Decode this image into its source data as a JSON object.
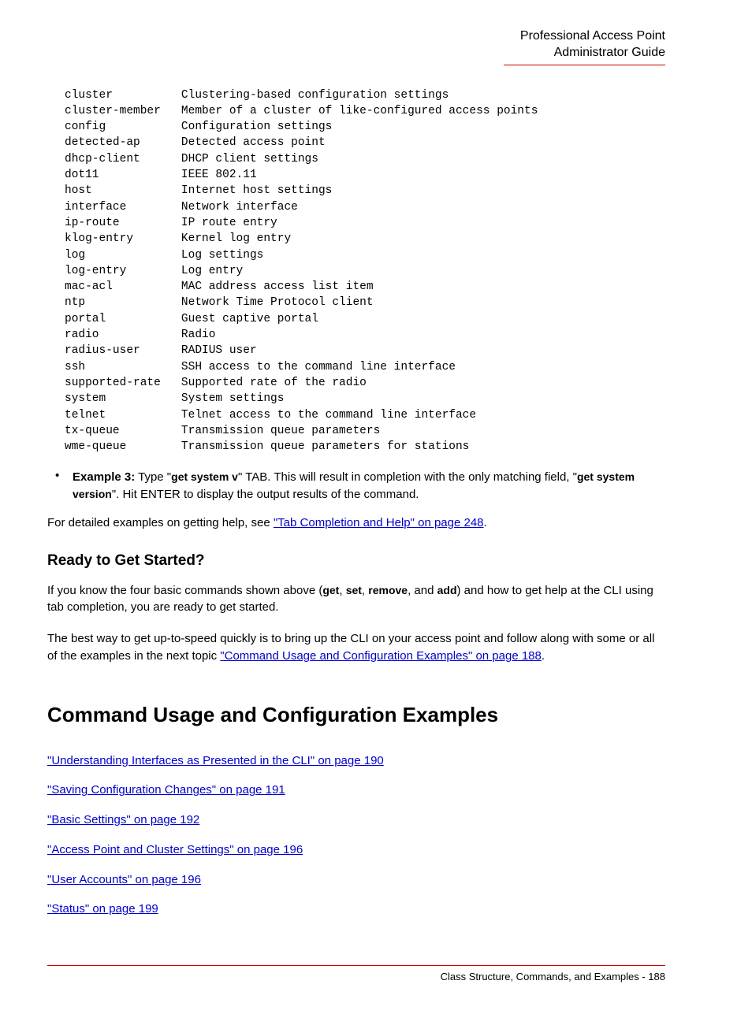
{
  "header": {
    "line1": "Professional Access Point",
    "line2": "Administrator Guide"
  },
  "mono_table": [
    {
      "k": "cluster",
      "v": "Clustering-based configuration settings"
    },
    {
      "k": "cluster-member",
      "v": "Member of a cluster of like-configured access points"
    },
    {
      "k": "config",
      "v": "Configuration settings"
    },
    {
      "k": "detected-ap",
      "v": "Detected access point"
    },
    {
      "k": "dhcp-client",
      "v": "DHCP client settings"
    },
    {
      "k": "dot11",
      "v": "IEEE 802.11"
    },
    {
      "k": "host",
      "v": "Internet host settings"
    },
    {
      "k": "interface",
      "v": "Network interface"
    },
    {
      "k": "ip-route",
      "v": "IP route entry"
    },
    {
      "k": "klog-entry",
      "v": "Kernel log entry"
    },
    {
      "k": "log",
      "v": "Log settings"
    },
    {
      "k": "log-entry",
      "v": "Log entry"
    },
    {
      "k": "mac-acl",
      "v": "MAC address access list item"
    },
    {
      "k": "ntp",
      "v": "Network Time Protocol client"
    },
    {
      "k": "portal",
      "v": "Guest captive portal"
    },
    {
      "k": "radio",
      "v": "Radio"
    },
    {
      "k": "radius-user",
      "v": "RADIUS user"
    },
    {
      "k": "ssh",
      "v": "SSH access to the command line interface"
    },
    {
      "k": "supported-rate",
      "v": "Supported rate of the radio"
    },
    {
      "k": "system",
      "v": "System settings"
    },
    {
      "k": "telnet",
      "v": "Telnet access to the command line interface"
    },
    {
      "k": "tx-queue",
      "v": "Transmission queue parameters"
    },
    {
      "k": "wme-queue",
      "v": "Transmission queue parameters for stations"
    }
  ],
  "example3": {
    "label": "Example 3:",
    "t1": " Type \"",
    "cmd1": "get system v",
    "t2": "\" TAB. This will result in completion with the only matching field, \"",
    "cmd2": "get system version",
    "t3": "\". Hit ENTER to display the output results of the command."
  },
  "detail_line": {
    "pre": "For detailed examples on getting help, see ",
    "link": "\"Tab Completion and Help\" on page 248",
    "post": "."
  },
  "ready_heading": "Ready to Get Started?",
  "ready_p1": {
    "a": "If you know the four basic commands shown above (",
    "c1": "get",
    "s1": ", ",
    "c2": "set",
    "s2": ", ",
    "c3": "remove",
    "s3": ", and ",
    "c4": "add",
    "b": ") and how to get help at the CLI using tab completion, you are ready to get started."
  },
  "ready_p2": {
    "pre": "The best way to get up-to-speed quickly is to bring up the CLI on your access point and follow along with some or all of the examples in the next topic ",
    "link": "\"Command Usage and Configuration Examples\" on page 188",
    "post": "."
  },
  "usage_heading": "Command Usage and Configuration Examples",
  "links": [
    "\"Understanding Interfaces as Presented in the CLI\" on page 190",
    "\"Saving Configuration Changes\" on page 191",
    "\"Basic Settings\" on page 192",
    "\"Access Point and Cluster Settings\" on page 196",
    "\"User Accounts\" on page 196",
    "\"Status\" on page 199"
  ],
  "footer": "Class Structure, Commands, and Examples - 188"
}
